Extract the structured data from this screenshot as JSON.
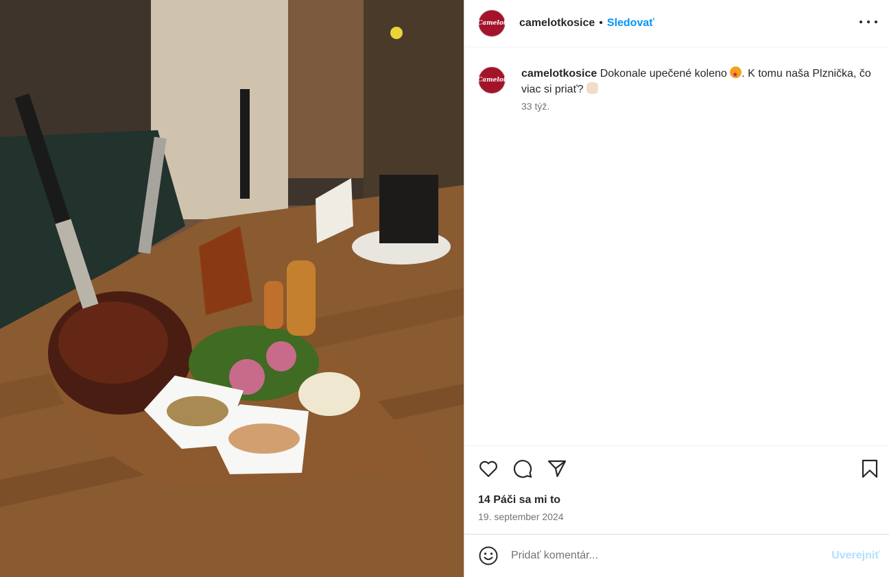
{
  "post": {
    "username": "camelotkosice",
    "follow_label": "Sledovať",
    "avatar_text": "Camelot",
    "caption": {
      "username": "camelotkosice",
      "text_part1": " Dokonale upečené koleno ",
      "text_part2": ". K tomu naša Plznička, čo viac si priať? ",
      "time": "33 týž."
    },
    "likes": "14 Páči sa mi to",
    "date": "19. september 2024",
    "comment_placeholder": "Pridať komentár...",
    "post_label": "Uverejniť"
  },
  "icons": {
    "more": "more-options-icon",
    "like": "heart-icon",
    "comment": "comment-bubble-icon",
    "share": "paper-plane-icon",
    "save": "bookmark-icon",
    "emoji": "smiley-icon"
  },
  "colors": {
    "follow": "#0095f6",
    "brand": "#a3142b",
    "post_disabled": "#b2dffc"
  }
}
